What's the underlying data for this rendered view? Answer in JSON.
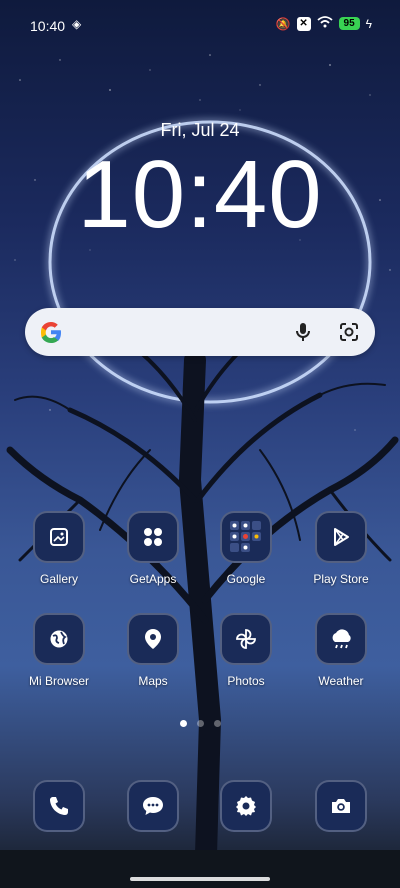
{
  "status": {
    "time": "10:40",
    "battery": "95"
  },
  "lock": {
    "date": "Fri, Jul 24",
    "clock": "10:40"
  },
  "apps_row1": [
    {
      "label": "Gallery"
    },
    {
      "label": "GetApps"
    },
    {
      "label": "Google"
    },
    {
      "label": "Play Store"
    }
  ],
  "apps_row2": [
    {
      "label": "Mi Browser"
    },
    {
      "label": "Maps"
    },
    {
      "label": "Photos"
    },
    {
      "label": "Weather"
    }
  ],
  "dock": [
    "phone-icon",
    "messages-icon",
    "settings-icon",
    "camera-icon"
  ],
  "pager": {
    "pages": 3,
    "current": 1
  },
  "colors": {
    "icon_bg": "#1a2b58",
    "battery": "#39d353",
    "search_bg": "#eef1f7"
  }
}
